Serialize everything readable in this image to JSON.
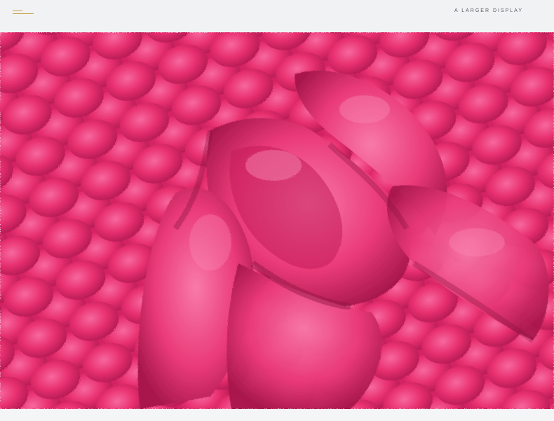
{
  "header": {
    "caption": "A LARGER DISPLAY",
    "logo_icon": "logo-lines-mark"
  },
  "photo": {
    "subject_icon": "plush-fabric-photo",
    "colors": {
      "base": "#e8276e",
      "light": "#f6629a",
      "dark": "#a8184c"
    }
  }
}
